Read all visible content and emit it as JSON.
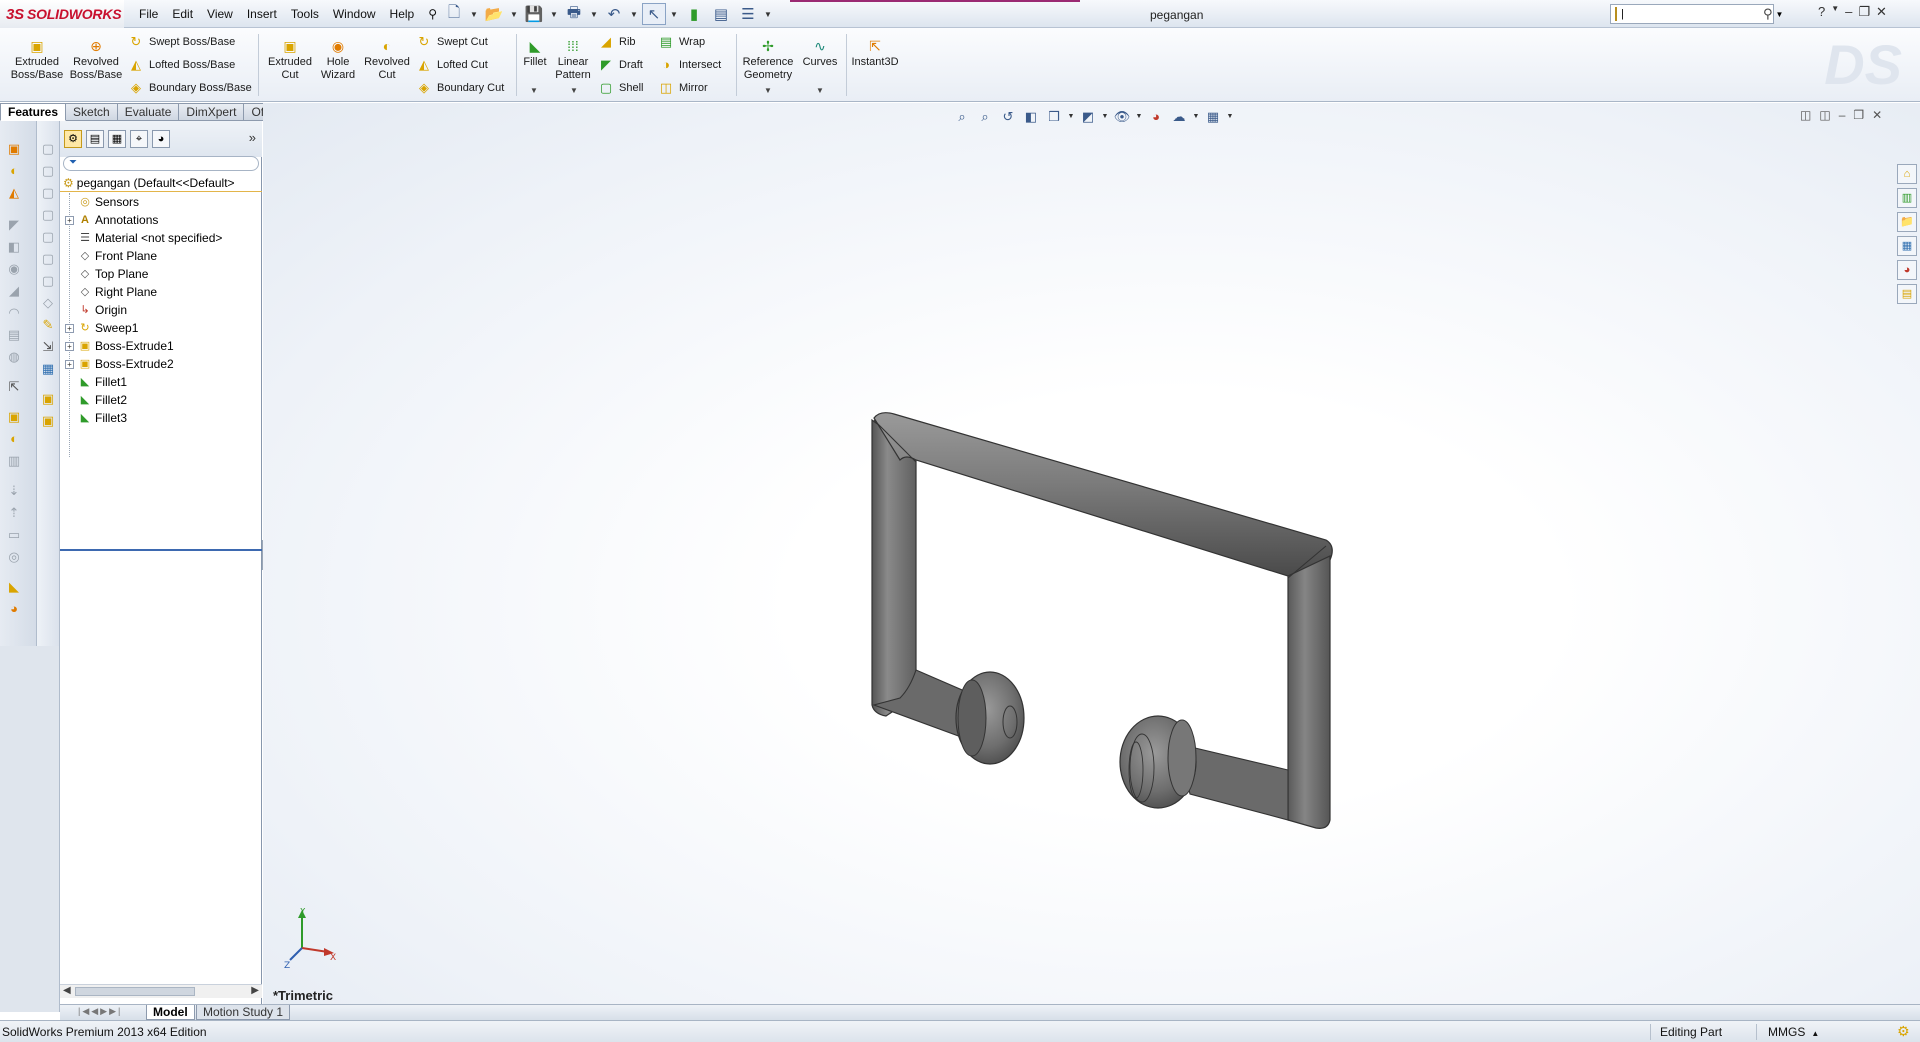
{
  "app": {
    "brand": "SOLIDWORKS",
    "document_title": "pegangan",
    "menu": [
      "File",
      "Edit",
      "View",
      "Insert",
      "Tools",
      "Window",
      "Help"
    ]
  },
  "search": {
    "value": "|",
    "placeholder": ""
  },
  "toolbar": {
    "extruded_boss": "Extruded Boss/Base",
    "revolved_boss": "Revolved Boss/Base",
    "swept_boss": "Swept Boss/Base",
    "lofted_boss": "Lofted Boss/Base",
    "boundary_boss": "Boundary Boss/Base",
    "extruded_cut": "Extruded Cut",
    "hole_wizard": "Hole Wizard",
    "revolved_cut": "Revolved Cut",
    "swept_cut": "Swept Cut",
    "lofted_cut": "Lofted Cut",
    "boundary_cut": "Boundary Cut",
    "fillet": "Fillet",
    "linear_pattern": "Linear Pattern",
    "rib": "Rib",
    "draft": "Draft",
    "shell": "Shell",
    "wrap": "Wrap",
    "intersect": "Intersect",
    "mirror": "Mirror",
    "reference_geometry": "Reference Geometry",
    "curves": "Curves",
    "instant3d": "Instant3D"
  },
  "tabs": [
    "Features",
    "Sketch",
    "Evaluate",
    "DimXpert",
    "Office Products"
  ],
  "feature_manager": {
    "root": "pegangan  (Default<<Default>",
    "items": [
      {
        "label": "Sensors",
        "icon": "sensor-icon",
        "expandable": false
      },
      {
        "label": "Annotations",
        "icon": "annotations-icon",
        "expandable": true
      },
      {
        "label": "Material <not specified>",
        "icon": "material-icon",
        "expandable": false
      },
      {
        "label": "Front Plane",
        "icon": "plane-icon",
        "expandable": false
      },
      {
        "label": "Top Plane",
        "icon": "plane-icon",
        "expandable": false
      },
      {
        "label": "Right Plane",
        "icon": "plane-icon",
        "expandable": false
      },
      {
        "label": "Origin",
        "icon": "origin-icon",
        "expandable": false
      },
      {
        "label": "Sweep1",
        "icon": "sweep-icon",
        "expandable": true
      },
      {
        "label": "Boss-Extrude1",
        "icon": "extrude-icon",
        "expandable": true
      },
      {
        "label": "Boss-Extrude2",
        "icon": "extrude-icon",
        "expandable": true
      },
      {
        "label": "Fillet1",
        "icon": "fillet-icon",
        "expandable": false
      },
      {
        "label": "Fillet2",
        "icon": "fillet-icon",
        "expandable": false
      },
      {
        "label": "Fillet3",
        "icon": "fillet-icon",
        "expandable": false
      }
    ]
  },
  "viewport": {
    "view_label": "*Trimetric"
  },
  "bottom_tabs": [
    "Model",
    "Motion Study 1"
  ],
  "status": {
    "edition": "SolidWorks Premium 2013 x64 Edition",
    "mode": "Editing Part",
    "units": "MMGS"
  },
  "colors": {
    "accent": "#c8102e",
    "feature_gold": "#d9a400",
    "model_grey": "#6e6e6e"
  }
}
